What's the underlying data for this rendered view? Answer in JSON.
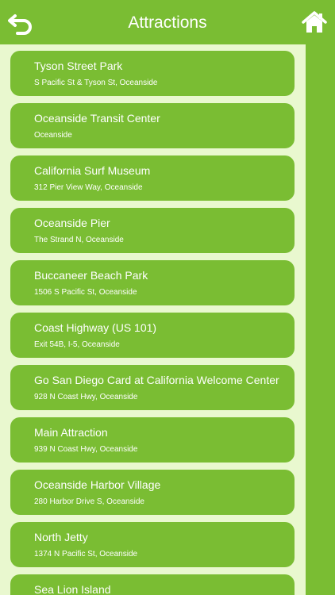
{
  "header": {
    "title": "Attractions",
    "back_icon": "back-arrow-icon",
    "home_icon": "home-icon"
  },
  "colors": {
    "primary": "#7abd33",
    "panel": "#e9f8cf",
    "text": "#ffffff"
  },
  "attractions": [
    {
      "name": "Tyson Street Park",
      "address": "S Pacific St & Tyson St, Oceanside"
    },
    {
      "name": "Oceanside Transit Center",
      "address": "Oceanside"
    },
    {
      "name": "California Surf Museum",
      "address": "312 Pier View Way, Oceanside"
    },
    {
      "name": "Oceanside Pier",
      "address": "The Strand N, Oceanside"
    },
    {
      "name": "Buccaneer Beach Park",
      "address": "1506 S Pacific St, Oceanside"
    },
    {
      "name": "Coast Highway (US 101)",
      "address": "Exit 54B, I-5, Oceanside"
    },
    {
      "name": "Go San Diego Card at California Welcome Center",
      "address": "928 N Coast Hwy, Oceanside"
    },
    {
      "name": "Main Attraction",
      "address": "939 N Coast Hwy, Oceanside"
    },
    {
      "name": "Oceanside Harbor Village",
      "address": "280 Harbor Drive S, Oceanside"
    },
    {
      "name": "North Jetty",
      "address": "1374 N Pacific St, Oceanside"
    },
    {
      "name": "Sea Lion Island",
      "address": ""
    }
  ]
}
